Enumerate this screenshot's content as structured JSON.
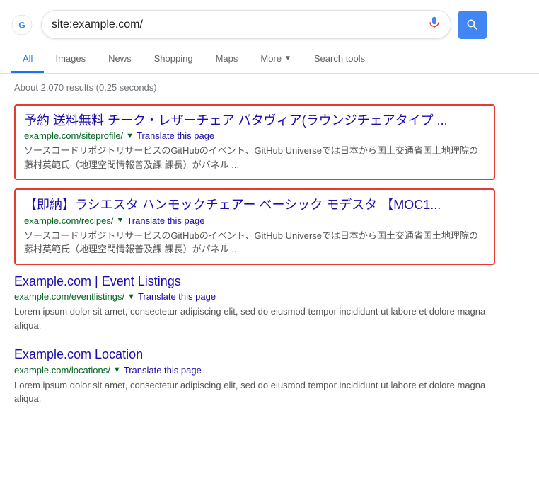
{
  "search": {
    "query": "site:example.com/",
    "placeholder": "Search",
    "mic_label": "Search by voice",
    "search_btn_label": "Search"
  },
  "nav": {
    "tabs": [
      {
        "id": "all",
        "label": "All",
        "active": true
      },
      {
        "id": "images",
        "label": "Images",
        "active": false
      },
      {
        "id": "news",
        "label": "News",
        "active": false
      },
      {
        "id": "shopping",
        "label": "Shopping",
        "active": false
      },
      {
        "id": "maps",
        "label": "Maps",
        "active": false
      },
      {
        "id": "more",
        "label": "More",
        "active": false,
        "has_arrow": true
      },
      {
        "id": "search-tools",
        "label": "Search tools",
        "active": false
      }
    ]
  },
  "results": {
    "count_text": "About 2,070 results (0.25 seconds)",
    "items": [
      {
        "id": "result-1",
        "highlighted": true,
        "title": "予約 送料無料 チーク・レザーチェア バタヴィア(ラウンジチェアタイプ ...",
        "url": "example.com/siteprofile/",
        "translate_text": "Translate this page",
        "snippet": "ソースコードリポジトリサービスのGitHubのイベント、GitHub Universeでは日本から国土交通省国土地理院の藤村英範氏（地理空間情報普及課 課長）がパネル ..."
      },
      {
        "id": "result-2",
        "highlighted": true,
        "title": "【即納】ラシエスタ ハンモックチェアー ベーシック モデスタ 【MOC1...",
        "url": "example.com/recipes/",
        "translate_text": "Translate this page",
        "snippet": "ソースコードリポジトリサービスのGitHubのイベント、GitHub Universeでは日本から国土交通省国土地理院の藤村英範氏（地理空間情報普及課 課長）がパネル ..."
      },
      {
        "id": "result-3",
        "highlighted": false,
        "title": "Example.com | Event Listings",
        "url": "example.com/eventlistings/",
        "translate_text": "Translate this page",
        "snippet": "Lorem ipsum dolor sit amet, consectetur adipiscing elit, sed do eiusmod tempor incididunt ut labore et dolore magna aliqua."
      },
      {
        "id": "result-4",
        "highlighted": false,
        "title": "Example.com Location",
        "url": "example.com/locations/",
        "translate_text": "Translate this page",
        "snippet": "Lorem ipsum dolor sit amet, consectetur adipiscing elit, sed do eiusmod tempor incididunt ut labore et dolore magna aliqua."
      }
    ]
  }
}
